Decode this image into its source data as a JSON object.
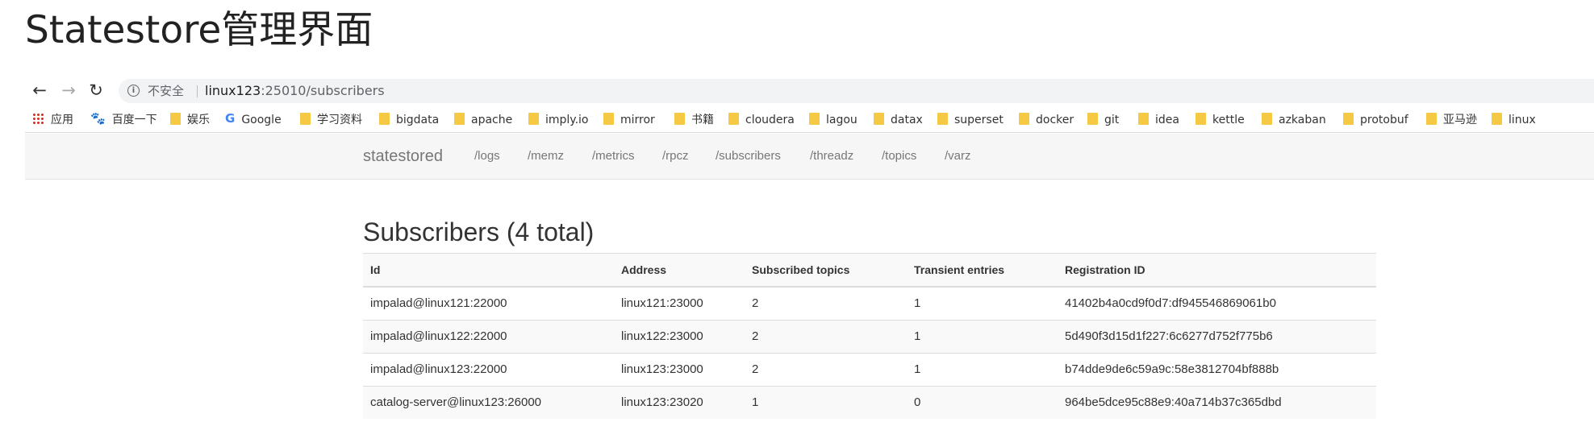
{
  "caption": "Statestore管理界面",
  "browser": {
    "nav": {
      "back": "←",
      "forward": "→",
      "reload": "↻"
    },
    "address_bar": {
      "info_icon": "info-icon",
      "security_label": "不安全",
      "url_host": "linux123",
      "url_rest": ":25010/subscribers"
    },
    "bookmarks": [
      {
        "label": "应用",
        "icon": "apps-icon"
      },
      {
        "label": "百度一下",
        "icon": "baidu-icon"
      },
      {
        "label": "娱乐",
        "icon": "folder-icon"
      },
      {
        "label": "Google",
        "icon": "google-icon"
      },
      {
        "label": "学习资料",
        "icon": "folder-icon"
      },
      {
        "label": "bigdata",
        "icon": "folder-icon"
      },
      {
        "label": "apache",
        "icon": "folder-icon"
      },
      {
        "label": "imply.io",
        "icon": "folder-icon"
      },
      {
        "label": "mirror",
        "icon": "folder-icon"
      },
      {
        "label": "书籍",
        "icon": "folder-icon"
      },
      {
        "label": "cloudera",
        "icon": "folder-icon"
      },
      {
        "label": "lagou",
        "icon": "folder-icon"
      },
      {
        "label": "datax",
        "icon": "folder-icon"
      },
      {
        "label": "superset",
        "icon": "folder-icon"
      },
      {
        "label": "docker",
        "icon": "folder-icon"
      },
      {
        "label": "git",
        "icon": "folder-icon"
      },
      {
        "label": "idea",
        "icon": "folder-icon"
      },
      {
        "label": "kettle",
        "icon": "folder-icon"
      },
      {
        "label": "azkaban",
        "icon": "folder-icon"
      },
      {
        "label": "protobuf",
        "icon": "folder-icon"
      },
      {
        "label": "亚马逊",
        "icon": "folder-icon"
      },
      {
        "label": "linux",
        "icon": "folder-icon"
      }
    ]
  },
  "navbar": {
    "brand": "statestored",
    "links": [
      "/logs",
      "/memz",
      "/metrics",
      "/rpcz",
      "/subscribers",
      "/threadz",
      "/topics",
      "/varz"
    ]
  },
  "page": {
    "heading": "Subscribers (4 total)",
    "table": {
      "headers": [
        "Id",
        "Address",
        "Subscribed topics",
        "Transient entries",
        "Registration ID"
      ],
      "rows": [
        [
          "impalad@linux121:22000",
          "linux121:23000",
          "2",
          "1",
          "41402b4a0cd9f0d7:df945546869061b0"
        ],
        [
          "impalad@linux122:22000",
          "linux122:23000",
          "2",
          "1",
          "5d490f3d15d1f227:6c6277d752f775b6"
        ],
        [
          "impalad@linux123:22000",
          "linux123:23000",
          "2",
          "1",
          "b74dde9de6c59a9c:58e3812704bf888b"
        ],
        [
          "catalog-server@linux123:26000",
          "linux123:23020",
          "1",
          "0",
          "964be5dce95c88e9:40a714b37c365dbd"
        ]
      ]
    }
  },
  "colors": {
    "folder": "#f6c945",
    "navbar_bg": "#f6f6f6",
    "stripe": "#f9f9f9",
    "text": "#333333"
  }
}
